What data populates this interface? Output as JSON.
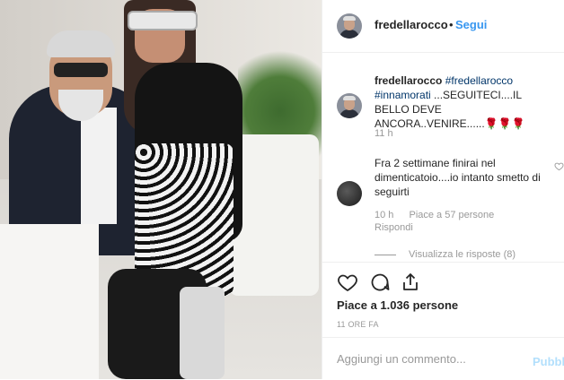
{
  "post": {
    "username": "fredellarocco",
    "follow_label": "Segui",
    "dot": "•"
  },
  "caption": {
    "username": "fredellarocco",
    "hashtag1": "#fredellarocco",
    "hashtag2": "#innamorati",
    "text": " ...SEGUITECI....IL BELLO DEVE ANCORA..VENIRE......🌹🌹🌹",
    "time": "11 h"
  },
  "comment": {
    "text": "Fra 2 settimane finirai nel dimenticatoio....io intanto smetto di seguirti",
    "time": "10 h",
    "likes": "Piace a 57 persone",
    "reply": "Rispondi",
    "view_replies": "Visualizza le risposte (8)",
    "heart_icon": "heart-outline-icon"
  },
  "actions": {
    "like_icon": "heart-icon",
    "comment_icon": "comment-icon",
    "share_icon": "share-icon"
  },
  "likes_text": "Piace a 1.036 persone",
  "post_time": "11 ORE FA",
  "add_comment": {
    "placeholder": "Aggiungi un commento...",
    "publish_label": "Pubblica"
  }
}
